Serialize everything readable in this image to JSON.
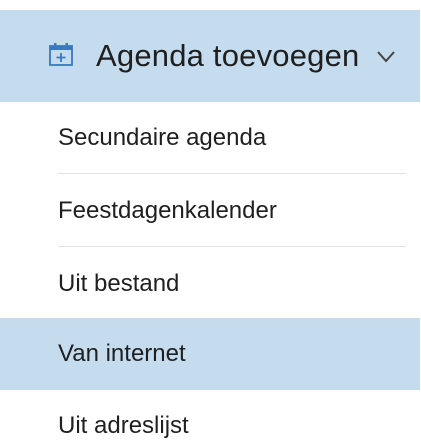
{
  "header": {
    "label": "Agenda toevoegen",
    "icon": "calendar-add-icon",
    "chevron_icon": "chevron-down-icon"
  },
  "items": [
    {
      "label": "Secundaire agenda"
    },
    {
      "label": "Feestdagenkalender"
    },
    {
      "label": "Uit bestand"
    },
    {
      "label": "Van internet",
      "selected": true
    },
    {
      "label": "Uit adreslijst"
    }
  ],
  "colors": {
    "highlight": "#c5dcef",
    "accent": "#3a78c2",
    "text": "#1f1f1f",
    "divider": "#e3e3e3"
  }
}
